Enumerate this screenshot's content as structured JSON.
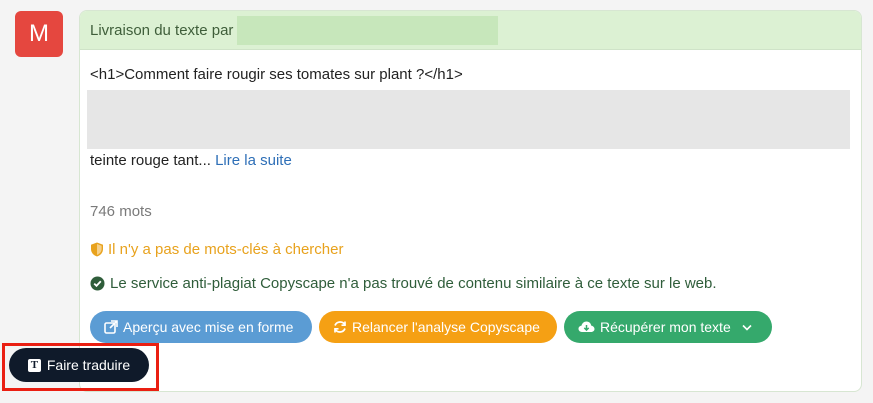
{
  "avatar": {
    "letter": "M"
  },
  "header": {
    "label": "Livraison du texte par"
  },
  "content": {
    "heading": "<h1>Comment faire rougir ses tomates sur plant ?</h1>",
    "excerpt": "teinte rouge tant...",
    "read_more": "Lire la suite",
    "word_count": "746 mots",
    "warning": "Il n'y a pas de mots-clés à chercher",
    "success": "Le service anti-plagiat Copyscape n'a pas trouvé de contenu similaire à ce texte sur le web."
  },
  "actions": {
    "preview": "Aperçu avec mise en forme",
    "rerun": "Relancer l'analyse Copyscape",
    "download": "Récupérer mon texte",
    "translate": "Faire traduire"
  },
  "colors": {
    "avatar": "#e5473f",
    "header_bg": "#dcf1d3",
    "link": "#2e6fb7",
    "warning": "#e8a21d",
    "success": "#2f5d3a",
    "btn_blue": "#5b9cd4",
    "btn_orange": "#f5a014",
    "btn_green": "#35a96c",
    "btn_dark": "#0f1a2a",
    "highlight": "#ea1f12"
  },
  "icons": [
    "external-link-icon",
    "refresh-icon",
    "cloud-download-icon",
    "chevron-down-icon",
    "shield-icon",
    "check-circle-icon",
    "translate-icon"
  ]
}
